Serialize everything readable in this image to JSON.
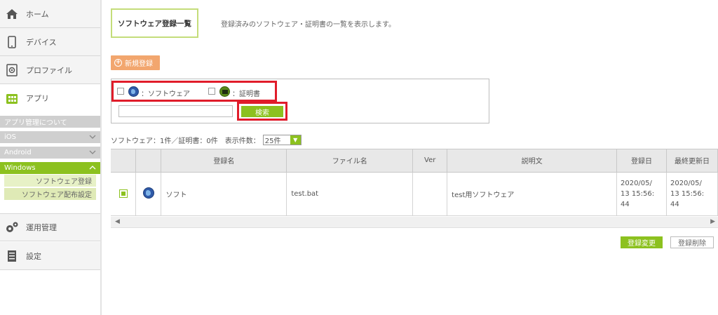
{
  "sidebar": {
    "home": "ホーム",
    "device": "デバイス",
    "profile": "プロファイル",
    "app": "アプリ",
    "app_about": "アプリ管理について",
    "ios": "iOS",
    "android": "Android",
    "windows": "Windows",
    "software_register": "ソフトウェア登録",
    "software_distribution": "ソフトウェア配布設定",
    "operations": "運用管理",
    "settings": "設定"
  },
  "header": {
    "title": "ソフトウェア登録一覧",
    "description": "登録済みのソフトウェア・証明書の一覧を表示します。"
  },
  "toolbar": {
    "new_label": "新規登録"
  },
  "filter": {
    "software_label": "：ソフトウェア",
    "cert_label": "：証明書",
    "search_value": "",
    "search_button": "検索"
  },
  "summary": {
    "text": "ソフトウェア：1件／証明書：0件　表示件数：",
    "per_page": "25件"
  },
  "table": {
    "columns": [
      "",
      "",
      "登録名",
      "ファイル名",
      "Ver",
      "説明文",
      "登録日",
      "最終更新日"
    ],
    "rows": [
      {
        "name": "ソフト",
        "file": "test.bat",
        "ver": "",
        "description": "test用ソフトウェア",
        "registered": "2020/05/\n13 15:56:\n44",
        "updated": "2020/05/\n13 15:56:\n44"
      }
    ]
  },
  "actions": {
    "update_label": "登録変更",
    "delete_label": "登録削除"
  },
  "colors": {
    "accent_green": "#8cc11f",
    "new_button_orange": "#f2a66e",
    "highlight_red": "#e01c2a"
  }
}
